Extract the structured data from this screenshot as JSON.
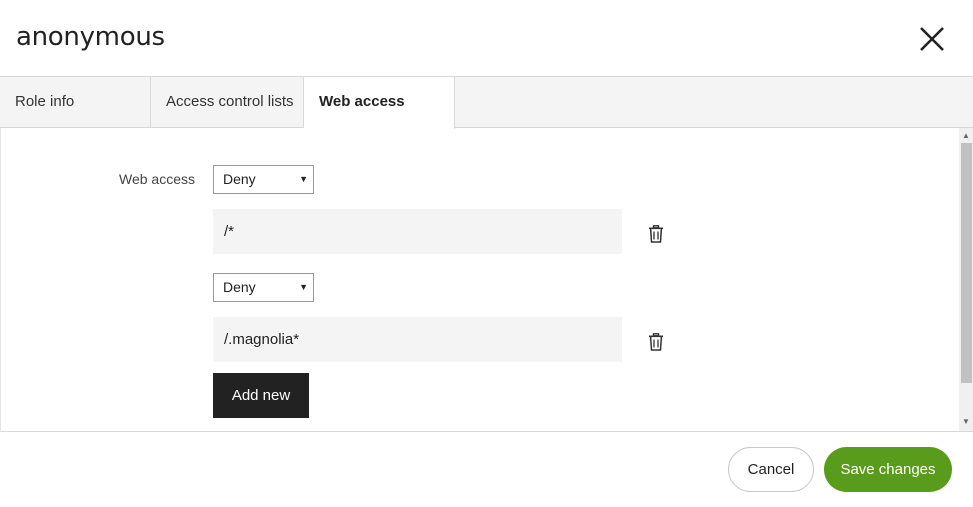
{
  "dialog": {
    "title": "anonymous"
  },
  "tabs": [
    {
      "label": "Role info",
      "active": false
    },
    {
      "label": "Access control lists",
      "active": false
    },
    {
      "label": "Web access",
      "active": true
    }
  ],
  "web_access": {
    "label": "Web access",
    "entries": [
      {
        "permission": "Deny",
        "path": "/*"
      },
      {
        "permission": "Deny",
        "path": "/.magnolia*"
      }
    ],
    "add_label": "Add new"
  },
  "footer": {
    "cancel_label": "Cancel",
    "save_label": "Save changes"
  },
  "colors": {
    "save_button": "#599b1b",
    "add_button": "#222222",
    "input_bg": "#f4f4f4"
  },
  "icons": {
    "close": "close-icon",
    "delete": "trash-icon"
  }
}
